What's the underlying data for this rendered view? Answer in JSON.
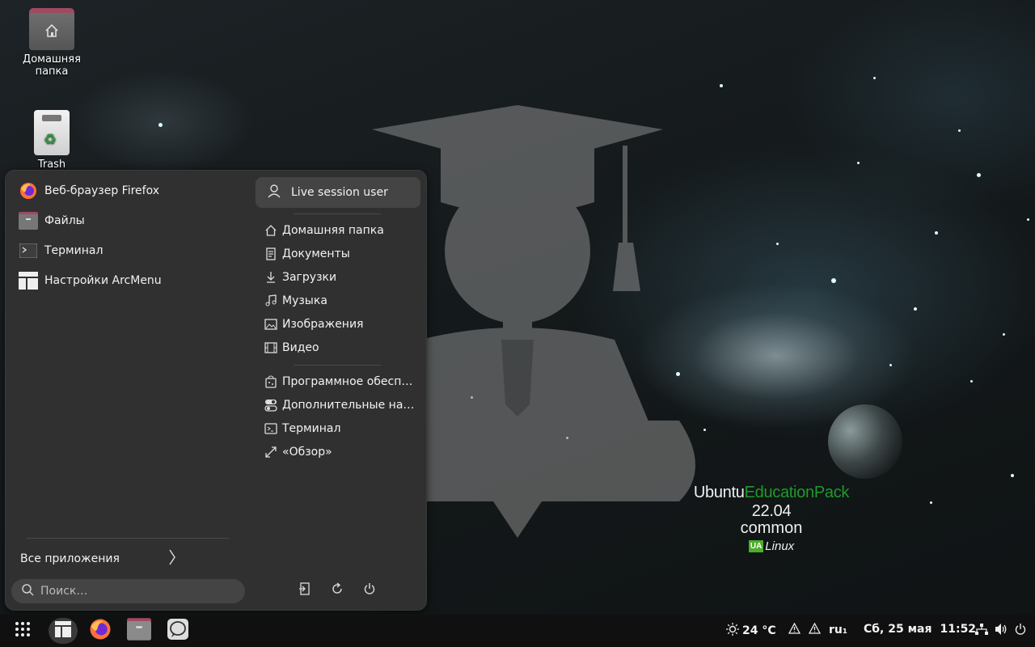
{
  "desktop": {
    "icons": [
      {
        "label": "Домашняя папка",
        "icon": "home-folder-icon"
      },
      {
        "label": "Trash",
        "icon": "trash-icon"
      }
    ],
    "brand": {
      "ubuntu": "Ubuntu",
      "edition": "EducationPack",
      "version": "22.04",
      "line2": "common",
      "logo_badge": "UA",
      "logo_text": "Linux"
    }
  },
  "menu": {
    "favorites": [
      {
        "label": "Веб-браузер Firefox",
        "icon": "firefox-icon"
      },
      {
        "label": "Файлы",
        "icon": "files-icon"
      },
      {
        "label": "Терминал",
        "icon": "terminal-icon"
      },
      {
        "label": "Настройки ArcMenu",
        "icon": "arcmenu-settings-icon"
      }
    ],
    "user": {
      "label": "Live session user",
      "icon": "user-icon"
    },
    "places": [
      {
        "label": "Домашняя папка",
        "icon": "home-icon"
      },
      {
        "label": "Документы",
        "icon": "document-icon"
      },
      {
        "label": "Загрузки",
        "icon": "download-icon"
      },
      {
        "label": "Музыка",
        "icon": "music-icon"
      },
      {
        "label": "Изображения",
        "icon": "image-icon"
      },
      {
        "label": "Видео",
        "icon": "video-icon"
      }
    ],
    "shortcuts": [
      {
        "label": "Программное обесп…",
        "icon": "software-icon"
      },
      {
        "label": "Дополнительные на…",
        "icon": "tweaks-icon"
      },
      {
        "label": "Терминал",
        "icon": "terminal-icon"
      },
      {
        "label": "«Обзор»",
        "icon": "overview-icon"
      }
    ],
    "all_apps_label": "Все приложения",
    "search_placeholder": "Поиск…",
    "power_buttons": [
      "logout-icon",
      "restart-icon",
      "power-icon"
    ]
  },
  "taskbar": {
    "apps": [
      "app-grid-icon",
      "arcmenu-icon",
      "firefox-icon",
      "files-icon",
      "chat-icon"
    ],
    "weather": "24 °C",
    "keyboard_layout": "ru₁",
    "date": "Сб, 25 мая",
    "time": "11:52",
    "accent": "#4caf2a"
  }
}
